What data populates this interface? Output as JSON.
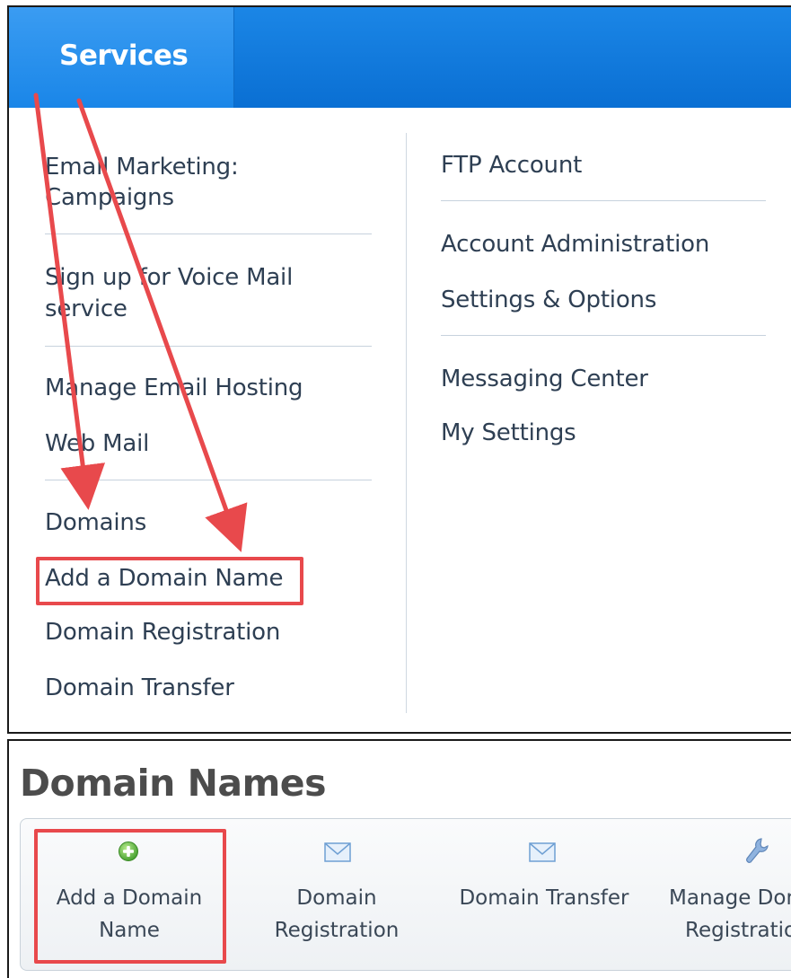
{
  "nav": {
    "services_label": "Services"
  },
  "menu": {
    "left": {
      "email_marketing_1": "Email Marketing:",
      "email_marketing_2": "Campaigns",
      "voice_mail_1": "Sign up for Voice Mail",
      "voice_mail_2": "service",
      "manage_email_hosting": "Manage Email Hosting",
      "web_mail": "Web Mail",
      "domains": "Domains",
      "add_domain_name": "Add a Domain Name",
      "domain_registration": "Domain Registration",
      "domain_transfer": "Domain Transfer"
    },
    "right": {
      "ftp_account": "FTP Account",
      "account_administration": "Account Administration",
      "settings_options": "Settings & Options",
      "messaging_center": "Messaging Center",
      "my_settings": "My Settings"
    }
  },
  "page": {
    "title": "Domain Names"
  },
  "toolbar": {
    "add_domain_1": "Add a Domain",
    "add_domain_2": "Name",
    "domain_registration_1": "Domain",
    "domain_registration_2": "Registration",
    "domain_transfer": "Domain Transfer",
    "manage_domain_1": "Manage Dom",
    "manage_domain_2": "Registratio"
  },
  "icons": {
    "add": "plus-circle-icon",
    "registration": "envelope-icon",
    "transfer": "envelope-icon",
    "manage": "wrench-icon"
  },
  "colors": {
    "nav_blue": "#0a6fd3",
    "highlight_red": "#e8494c",
    "link_text": "#2e3f53"
  }
}
